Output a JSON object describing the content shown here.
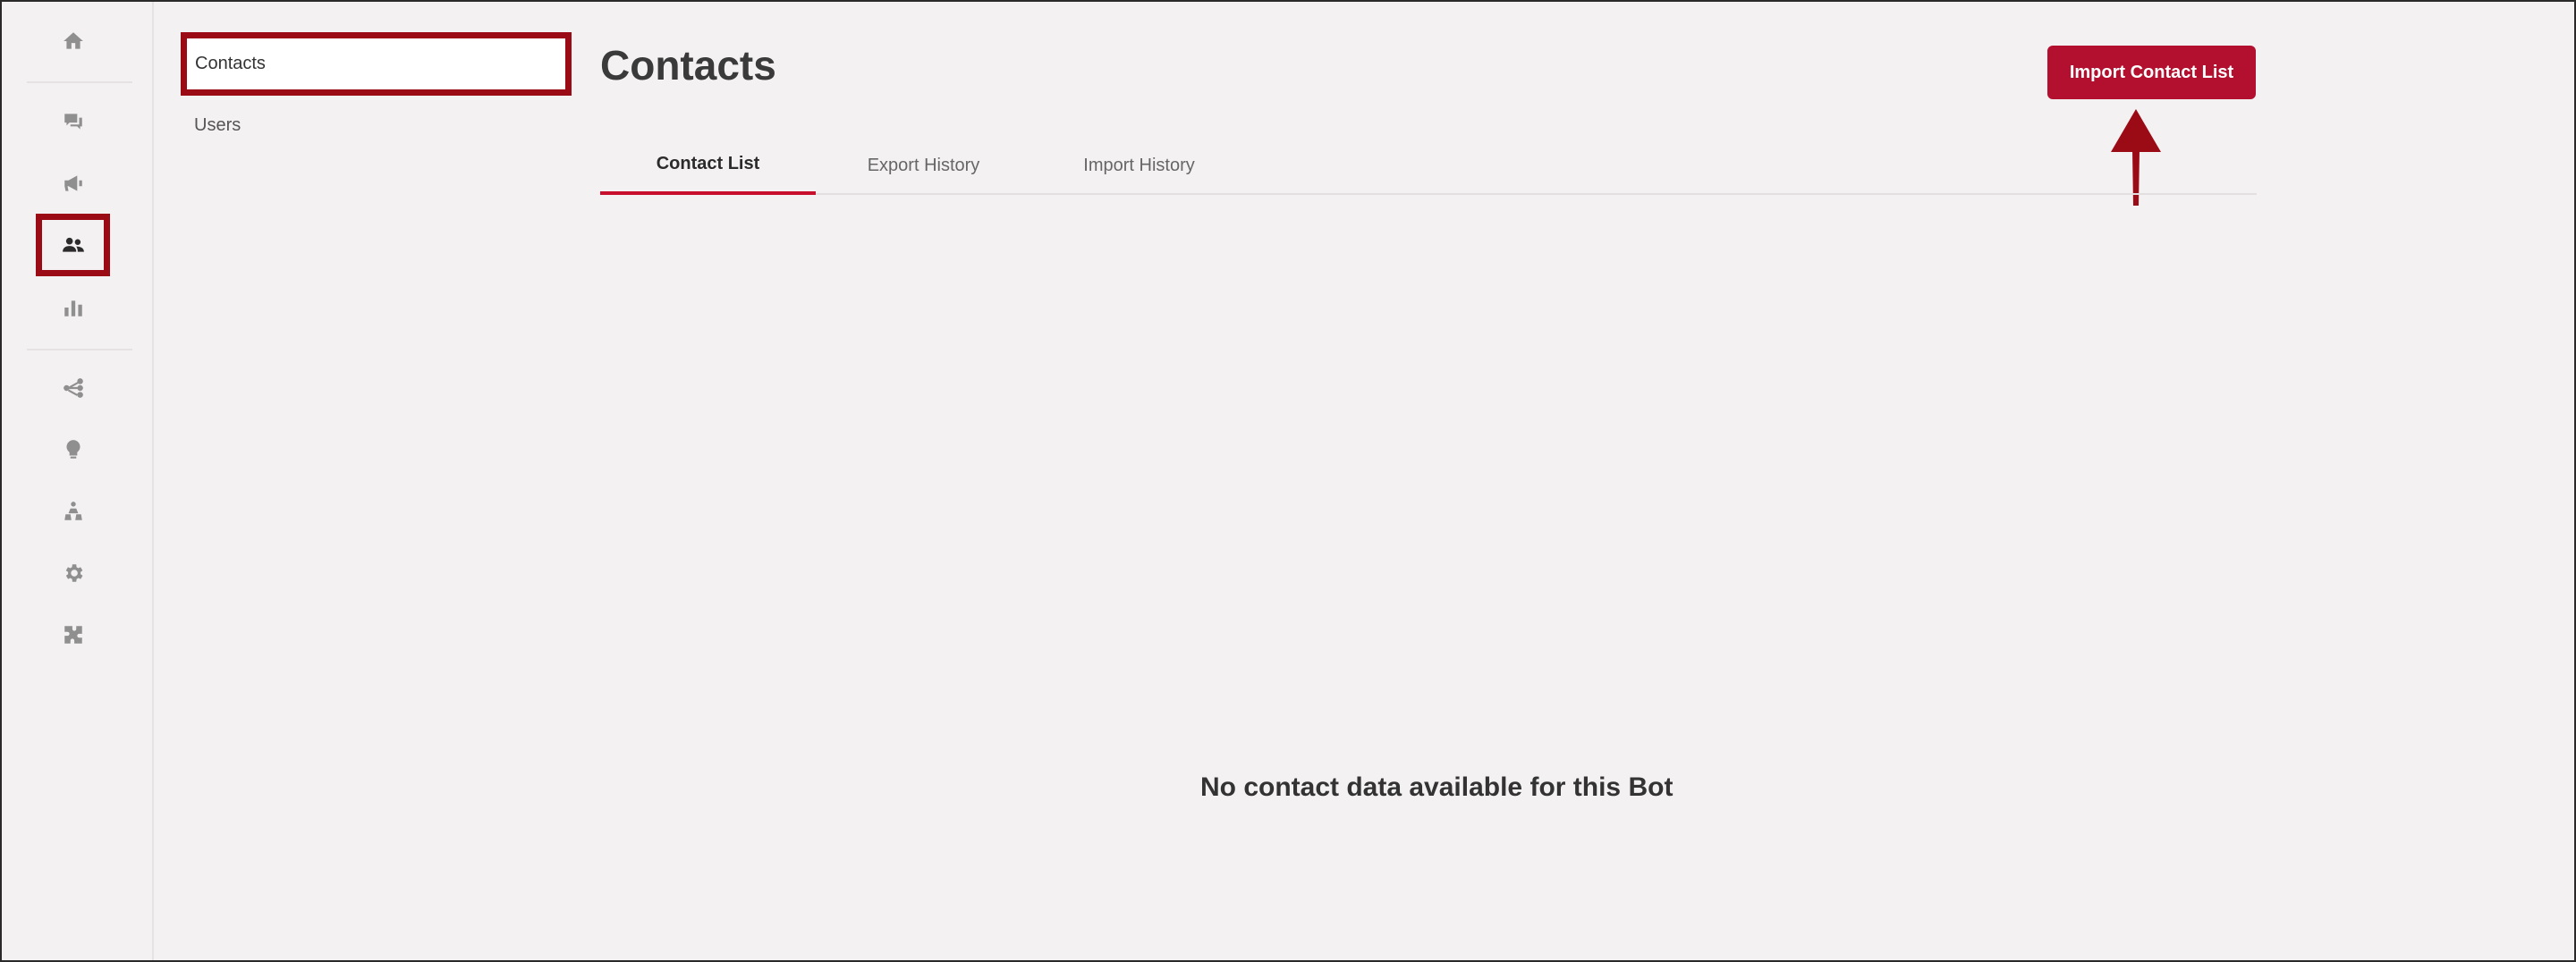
{
  "rail": {
    "icons": [
      "home-icon",
      "chat-icon",
      "megaphone-icon",
      "contacts-icon",
      "bar-chart-icon",
      "flow-icon",
      "lightbulb-icon",
      "hierarchy-icon",
      "gear-icon",
      "puzzle-icon"
    ],
    "active": "contacts-icon"
  },
  "subnav": {
    "items": [
      {
        "label": "Contacts",
        "active": true
      },
      {
        "label": "Users",
        "active": false
      }
    ]
  },
  "main": {
    "title": "Contacts",
    "import_button": "Import Contact List",
    "tabs": [
      {
        "label": "Contact List",
        "active": true
      },
      {
        "label": "Export History",
        "active": false
      },
      {
        "label": "Import History",
        "active": false
      }
    ],
    "empty_message": "No contact data available for this Bot"
  },
  "colors": {
    "accent": "#b2102e",
    "highlight": "#9a0b16",
    "background": "#f4f1f2"
  }
}
